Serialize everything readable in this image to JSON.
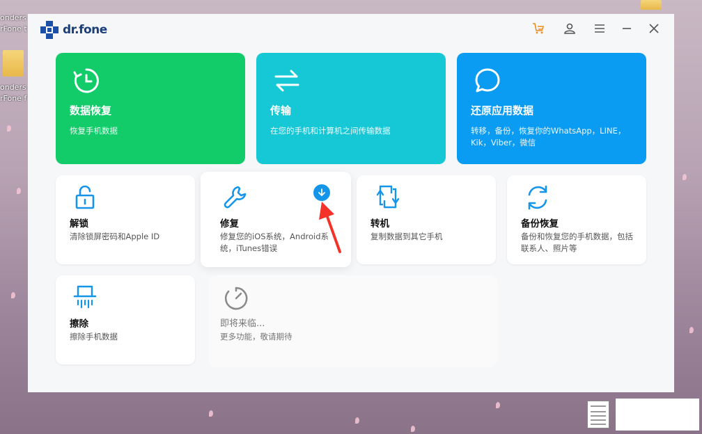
{
  "desktop": {
    "icon_text_1": "onders",
    "icon_text_2": "rFone t",
    "icon_text_3": "onders",
    "icon_text_4": "rFone f"
  },
  "app": {
    "logo": "dr.fone"
  },
  "cards": {
    "data_recovery": {
      "title": "数据恢复",
      "desc": "恢复手机数据",
      "icon": "clock-recover-icon",
      "color": "#12cc6a"
    },
    "transfer": {
      "title": "传输",
      "desc": "在您的手机和计算机之间传输数据",
      "icon": "transfer-arrows-icon",
      "color": "#16c8d6"
    },
    "restore_app": {
      "title": "还原应用数据",
      "desc": "转移，备份，恢复你的WhatsApp，LINE，Kik，Viber，微信",
      "icon": "chat-bubble-icon",
      "color": "#0a9bf2"
    },
    "unlock": {
      "title": "解锁",
      "desc": "清除锁屏密码和Apple ID",
      "icon": "unlock-icon"
    },
    "repair": {
      "title": "修复",
      "desc": "修复您的iOS系统，Android系统，iTunes错误",
      "icon": "wrench-icon",
      "badge": "download-icon"
    },
    "switch": {
      "title": "转机",
      "desc": "复制数据到其它手机",
      "icon": "phone-switch-icon"
    },
    "backup": {
      "title": "备份恢复",
      "desc": "备份和恢复您的手机数据，包括联系人、照片等",
      "icon": "backup-sync-icon"
    },
    "erase": {
      "title": "擦除",
      "desc": "擦除手机数据",
      "icon": "shredder-icon"
    },
    "coming": {
      "title": "即将来临...",
      "desc": "更多功能，敬请期待",
      "icon": "timer-icon"
    }
  }
}
